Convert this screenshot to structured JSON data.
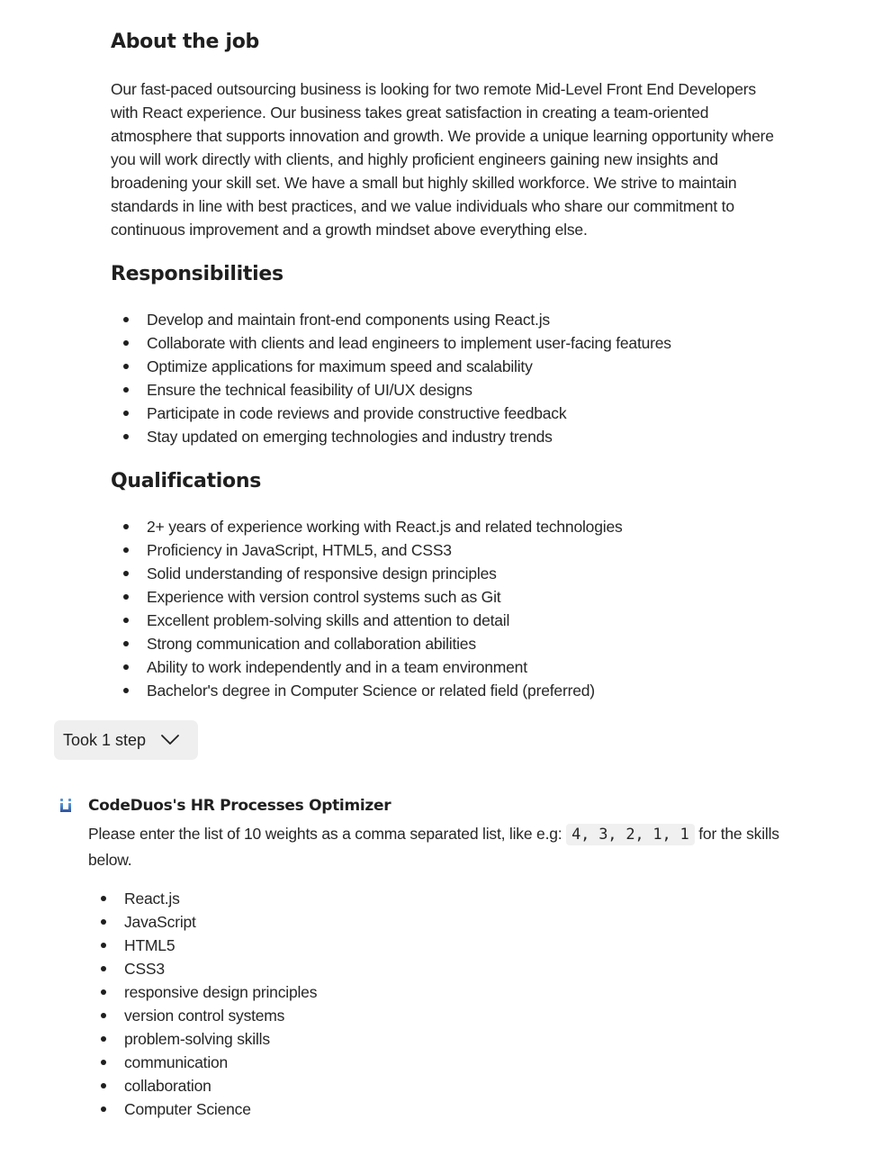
{
  "about": {
    "heading": "About the job",
    "paragraph": "Our fast-paced outsourcing business is looking for two remote Mid-Level Front End Developers with React experience. Our business takes great satisfaction in creating a team-oriented atmosphere that supports innovation and growth. We provide a unique learning opportunity where you will work directly with clients, and highly proficient engineers gaining new insights and broadening your skill set. We have a small but highly skilled workforce. We strive to maintain standards in line with best practices, and we value individuals who share our commitment to continuous improvement and a growth mindset above everything else."
  },
  "responsibilities": {
    "heading": "Responsibilities",
    "items": [
      "Develop and maintain front-end components using React.js",
      "Collaborate with clients and lead engineers to implement user-facing features",
      "Optimize applications for maximum speed and scalability",
      "Ensure the technical feasibility of UI/UX designs",
      "Participate in code reviews and provide constructive feedback",
      "Stay updated on emerging technologies and industry trends"
    ]
  },
  "qualifications": {
    "heading": "Qualifications",
    "items": [
      "2+ years of experience working with React.js and related technologies",
      "Proficiency in JavaScript, HTML5, and CSS3",
      "Solid understanding of responsive design principles",
      "Experience with version control systems such as Git",
      "Excellent problem-solving skills and attention to detail",
      "Strong communication and collaboration abilities",
      "Ability to work independently and in a team environment",
      "Bachelor's degree in Computer Science or related field (preferred)"
    ]
  },
  "steps_toggle": {
    "label": "Took 1 step",
    "icon": "chevron-down-icon"
  },
  "assistant_message": {
    "icon": "app-logo-icon",
    "sender": "CodeDuos's HR Processes Optimizer",
    "text_before": "Please enter the list of 10 weights as a comma separated list, like e.g:",
    "code_example": "4, 3, 2, 1, 1",
    "text_after": "for the skills below.",
    "skills": [
      "React.js",
      "JavaScript",
      "HTML5",
      "CSS3",
      "responsive design principles",
      "version control systems",
      "problem-solving skills",
      "communication",
      "collaboration",
      "Computer Science"
    ]
  }
}
